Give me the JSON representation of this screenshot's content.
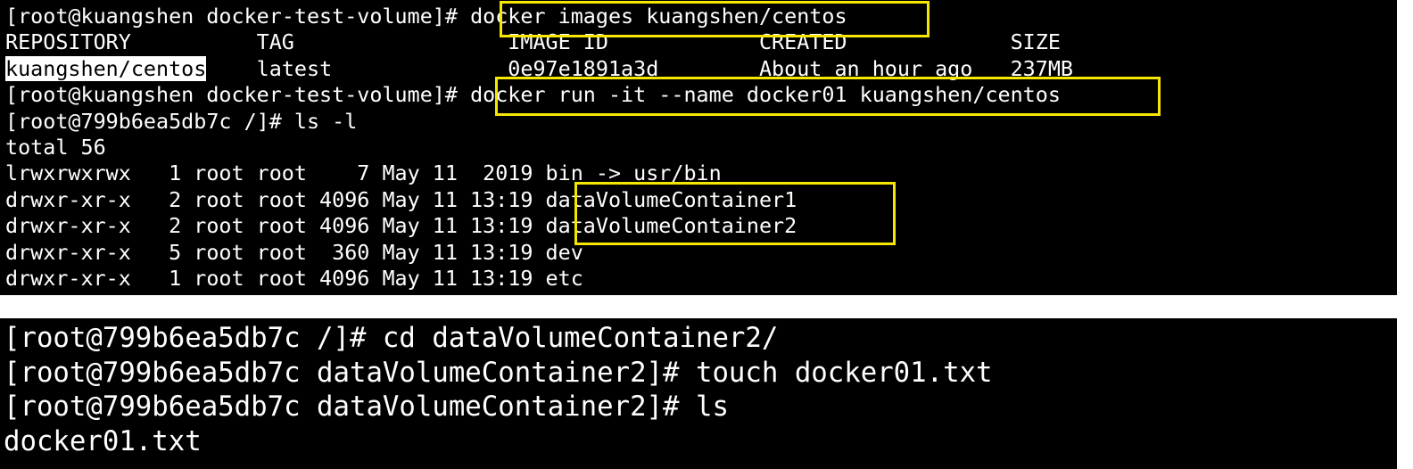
{
  "theme": {
    "terminal_background": "#000000",
    "terminal_text": "#ffffff",
    "highlight_box": "#f7e600"
  },
  "terminal1": {
    "lines": [
      {
        "prompt": "[root@kuangshen docker-test-volume]# ",
        "command": "docker images kuangshen/centos"
      },
      {
        "text": "REPOSITORY          TAG                 IMAGE ID            CREATED             SIZE"
      },
      {
        "selected": "kuangshen/centos",
        "text": "    latest              0e97e1891a3d        About an hour ago   237MB"
      },
      {
        "prompt": "[root@kuangshen docker-test-volume]# ",
        "command": "docker run -it --name docker01 kuangshen/centos"
      },
      {
        "text": "[root@799b6ea5db7c /]# ls -l"
      },
      {
        "text": "total 56"
      },
      {
        "text": "lrwxrwxrwx   1 root root    7 May 11  2019 bin -> usr/bin"
      },
      {
        "text": "drwxr-xr-x   2 root root 4096 May 11 13:19 ",
        "name": "dataVolumeContainer1"
      },
      {
        "text": "drwxr-xr-x   2 root root 4096 May 11 13:19 ",
        "name": "dataVolumeContainer2"
      },
      {
        "text": "drwxr-xr-x   5 root root  360 May 11 13:19 dev"
      },
      {
        "text": "drwxr-xr-x   1 root root 4096 May 11 13:19 etc"
      }
    ]
  },
  "terminal2": {
    "lines": [
      "[root@799b6ea5db7c /]# cd dataVolumeContainer2/",
      "[root@799b6ea5db7c dataVolumeContainer2]# touch docker01.txt",
      "[root@799b6ea5db7c dataVolumeContainer2]# ls",
      "docker01.txt"
    ]
  }
}
